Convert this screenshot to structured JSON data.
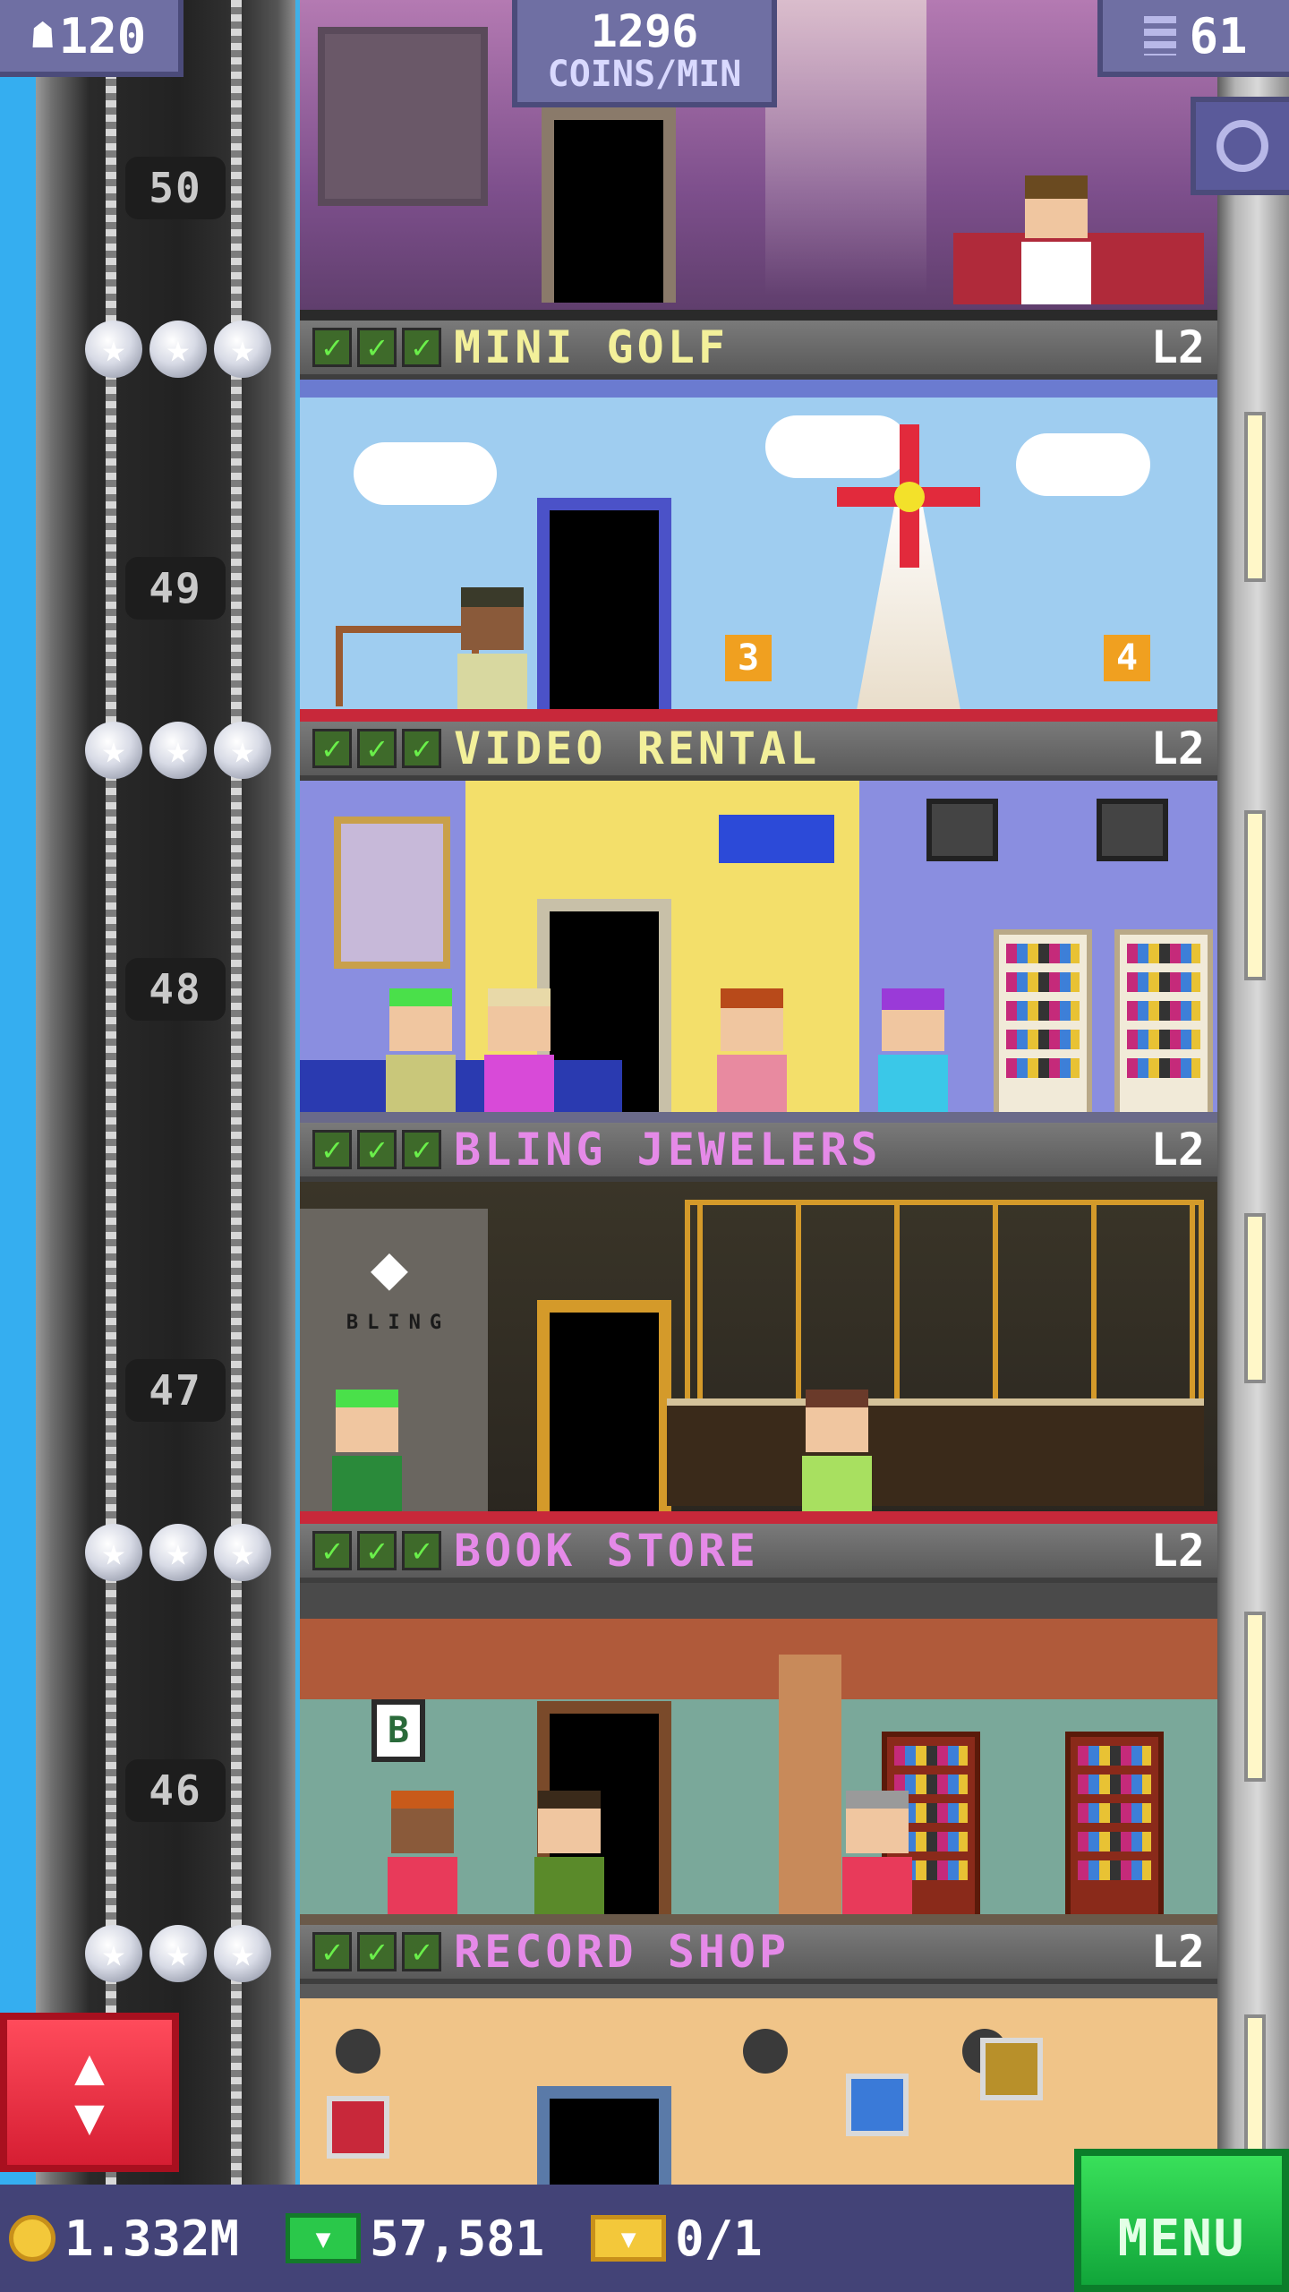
{
  "hud": {
    "population": "120",
    "coins_rate_value": "1296",
    "coins_rate_unit": "COINS/MIN",
    "floors_count": "61"
  },
  "shaft_floor_numbers": [
    "50",
    "49",
    "48",
    "47",
    "46"
  ],
  "floors": [
    {
      "name": "MINI GOLF",
      "level": "L2",
      "name_color": "#f3f09a",
      "sign_left": "3",
      "sign_right": "4"
    },
    {
      "name": "VIDEO RENTAL",
      "level": "L2",
      "name_color": "#f3f09a"
    },
    {
      "name": "BLING JEWELERS",
      "level": "L2",
      "name_color": "#e58ae8",
      "logo_text": "BLING"
    },
    {
      "name": "BOOK STORE",
      "level": "L2",
      "name_color": "#e58ae8",
      "bubble_text": "B"
    },
    {
      "name": "RECORD SHOP",
      "level": "L2",
      "name_color": "#e58ae8"
    }
  ],
  "bottom_bar": {
    "coins": "1.332M",
    "bux": "57,581",
    "tickets": "0/1",
    "menu_label": "MENU"
  },
  "colors": {
    "hud_bg": "#6f6fa3",
    "bottom_bar_bg": "#434377",
    "menu_green": "#1fc745",
    "elevator_red": "#e8283a",
    "check_green": "#6aef4a"
  }
}
